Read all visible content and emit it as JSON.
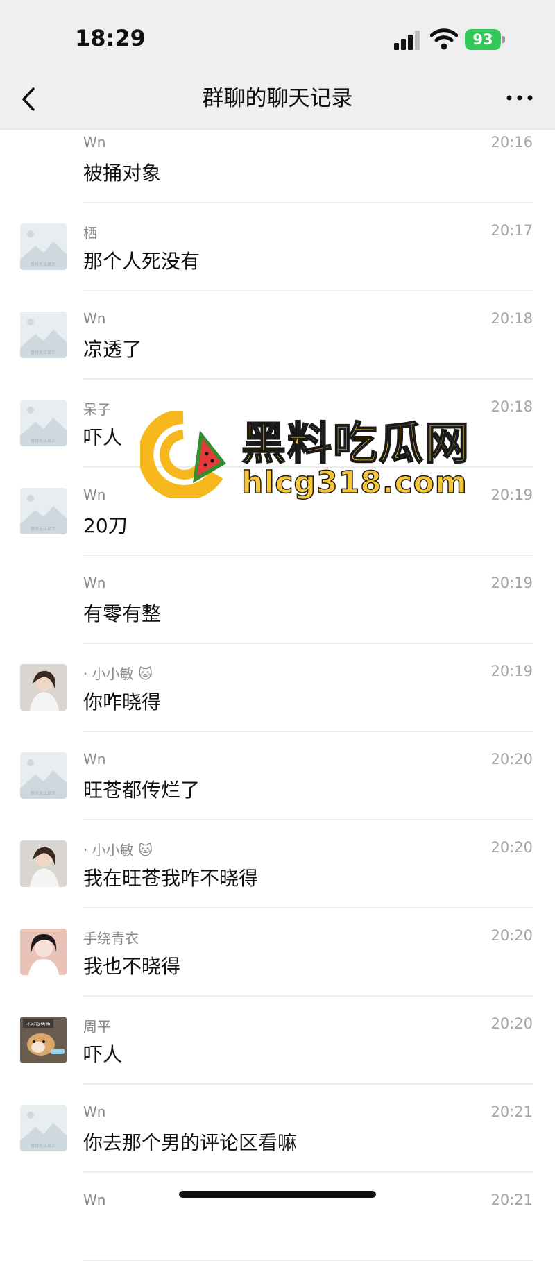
{
  "status_bar": {
    "time": "18:29",
    "battery": "93"
  },
  "header": {
    "title": "群聊的聊天记录"
  },
  "messages": [
    {
      "name": "Wn",
      "time": "20:16",
      "text": "被捅对象",
      "avatar": "none"
    },
    {
      "name": "栖",
      "time": "20:17",
      "text": "那个人死没有",
      "avatar": "placeholder"
    },
    {
      "name": "Wn",
      "time": "20:18",
      "text": "凉透了",
      "avatar": "placeholder"
    },
    {
      "name": "呆子",
      "time": "20:18",
      "text": "吓人",
      "avatar": "placeholder"
    },
    {
      "name": "Wn",
      "time": "20:19",
      "text": "20刀",
      "avatar": "placeholder"
    },
    {
      "name": "Wn",
      "time": "20:19",
      "text": "有零有整",
      "avatar": "none"
    },
    {
      "name": "· 小小敏 🐱",
      "time": "20:19",
      "text": "你咋晓得",
      "avatar": "girl"
    },
    {
      "name": "Wn",
      "time": "20:20",
      "text": "旺苍都传烂了",
      "avatar": "placeholder"
    },
    {
      "name": "· 小小敏 🐱",
      "time": "20:20",
      "text": "我在旺苍我咋不晓得",
      "avatar": "girl"
    },
    {
      "name": "手绕青衣",
      "time": "20:20",
      "text": "我也不晓得",
      "avatar": "girl2"
    },
    {
      "name": "周平",
      "time": "20:20",
      "text": "吓人",
      "avatar": "dog"
    },
    {
      "name": "Wn",
      "time": "20:21",
      "text": "你去那个男的评论区看嘛",
      "avatar": "placeholder"
    },
    {
      "name": "Wn",
      "time": "20:21",
      "text": "",
      "avatar": "none"
    }
  ],
  "avatar_caption": {
    "placeholder": "暂时无法显示",
    "dog": "不可以色色"
  },
  "watermark": {
    "name": "黑料吃瓜网",
    "url": "hlcg318.com"
  },
  "colors": {
    "battery": "#34c759",
    "watermark": "#f6c53a",
    "background": "#ffffff",
    "nav": "#efefef"
  }
}
